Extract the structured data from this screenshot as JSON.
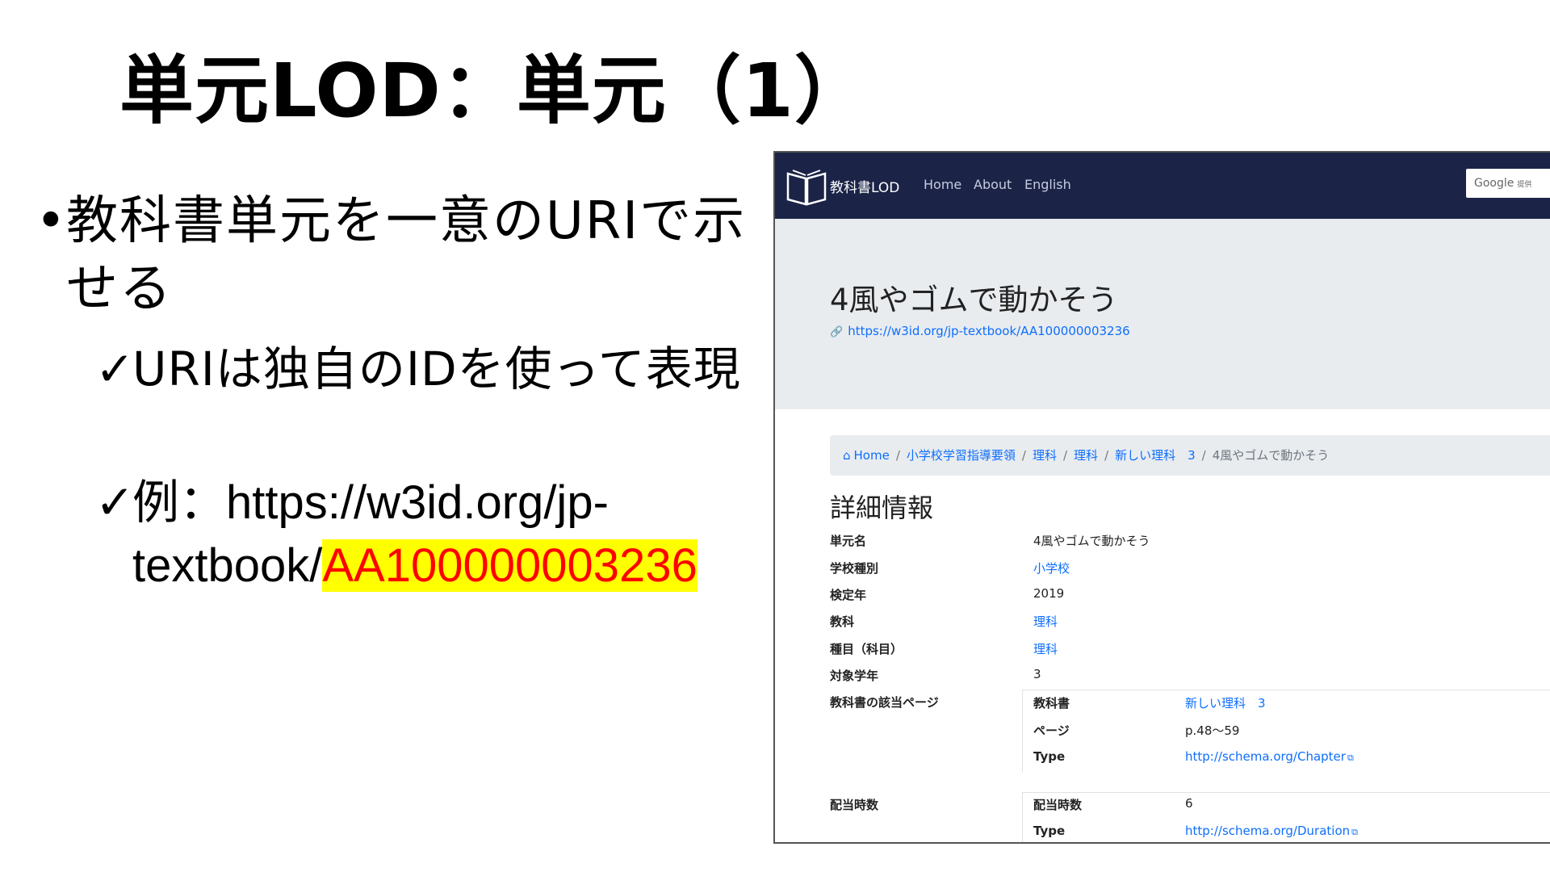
{
  "slide": {
    "title": "単元LOD：単元（1）",
    "bullet_dot": "•",
    "bullet_main": "教科書単元を一意のURIで示せる",
    "check_mark": "✓",
    "sub1": "URIは独自のIDを使って表現",
    "sub2_prefix": "例：https://w3id.org/jp-textbook/",
    "sub2_highlight": "AA100000003236"
  },
  "colors": {
    "navbar": "#1b2447",
    "jumbotron": "#e9ecef",
    "link": "#0d6efd",
    "highlight_bg": "#ffff00",
    "highlight_text": "#ff0000"
  },
  "site": {
    "logo_text": "教科書LOD",
    "logo_icon": "open-book-icon",
    "nav": [
      "Home",
      "About",
      "English"
    ],
    "search_brand": "Google",
    "search_brand_suffix": "提供"
  },
  "unit": {
    "heading": "4風やゴムで動かそう",
    "uri": "https://w3id.org/jp-textbook/AA100000003236"
  },
  "breadcrumb": {
    "items": [
      "Home",
      "小学校学習指導要領",
      "理科",
      "理科",
      "新しい理科　3"
    ],
    "current": "4風やゴムで動かそう",
    "separator": "/"
  },
  "details": {
    "heading": "詳細情報",
    "rows": [
      {
        "label": "単元名",
        "value": "4風やゴムで動かそう"
      },
      {
        "label": "学校種別",
        "value": "小学校"
      },
      {
        "label": "検定年",
        "value": "2019"
      },
      {
        "label": "教科",
        "value": "理科"
      },
      {
        "label": "種目（科目）",
        "value": "理科"
      },
      {
        "label": "対象学年",
        "value": "3"
      }
    ],
    "pages": {
      "label": "教科書の該当ページ",
      "rows": [
        {
          "label": "教科書",
          "value": "新しい理科　3"
        },
        {
          "label": "ページ",
          "value": "p.48〜59"
        },
        {
          "label": "Type",
          "value": "http://schema.org/Chapter"
        }
      ]
    },
    "hours": {
      "label": "配当時数",
      "rows": [
        {
          "label": "配当時数",
          "value": "6"
        },
        {
          "label": "Type",
          "value": "http://schema.org/Duration"
        }
      ]
    }
  }
}
